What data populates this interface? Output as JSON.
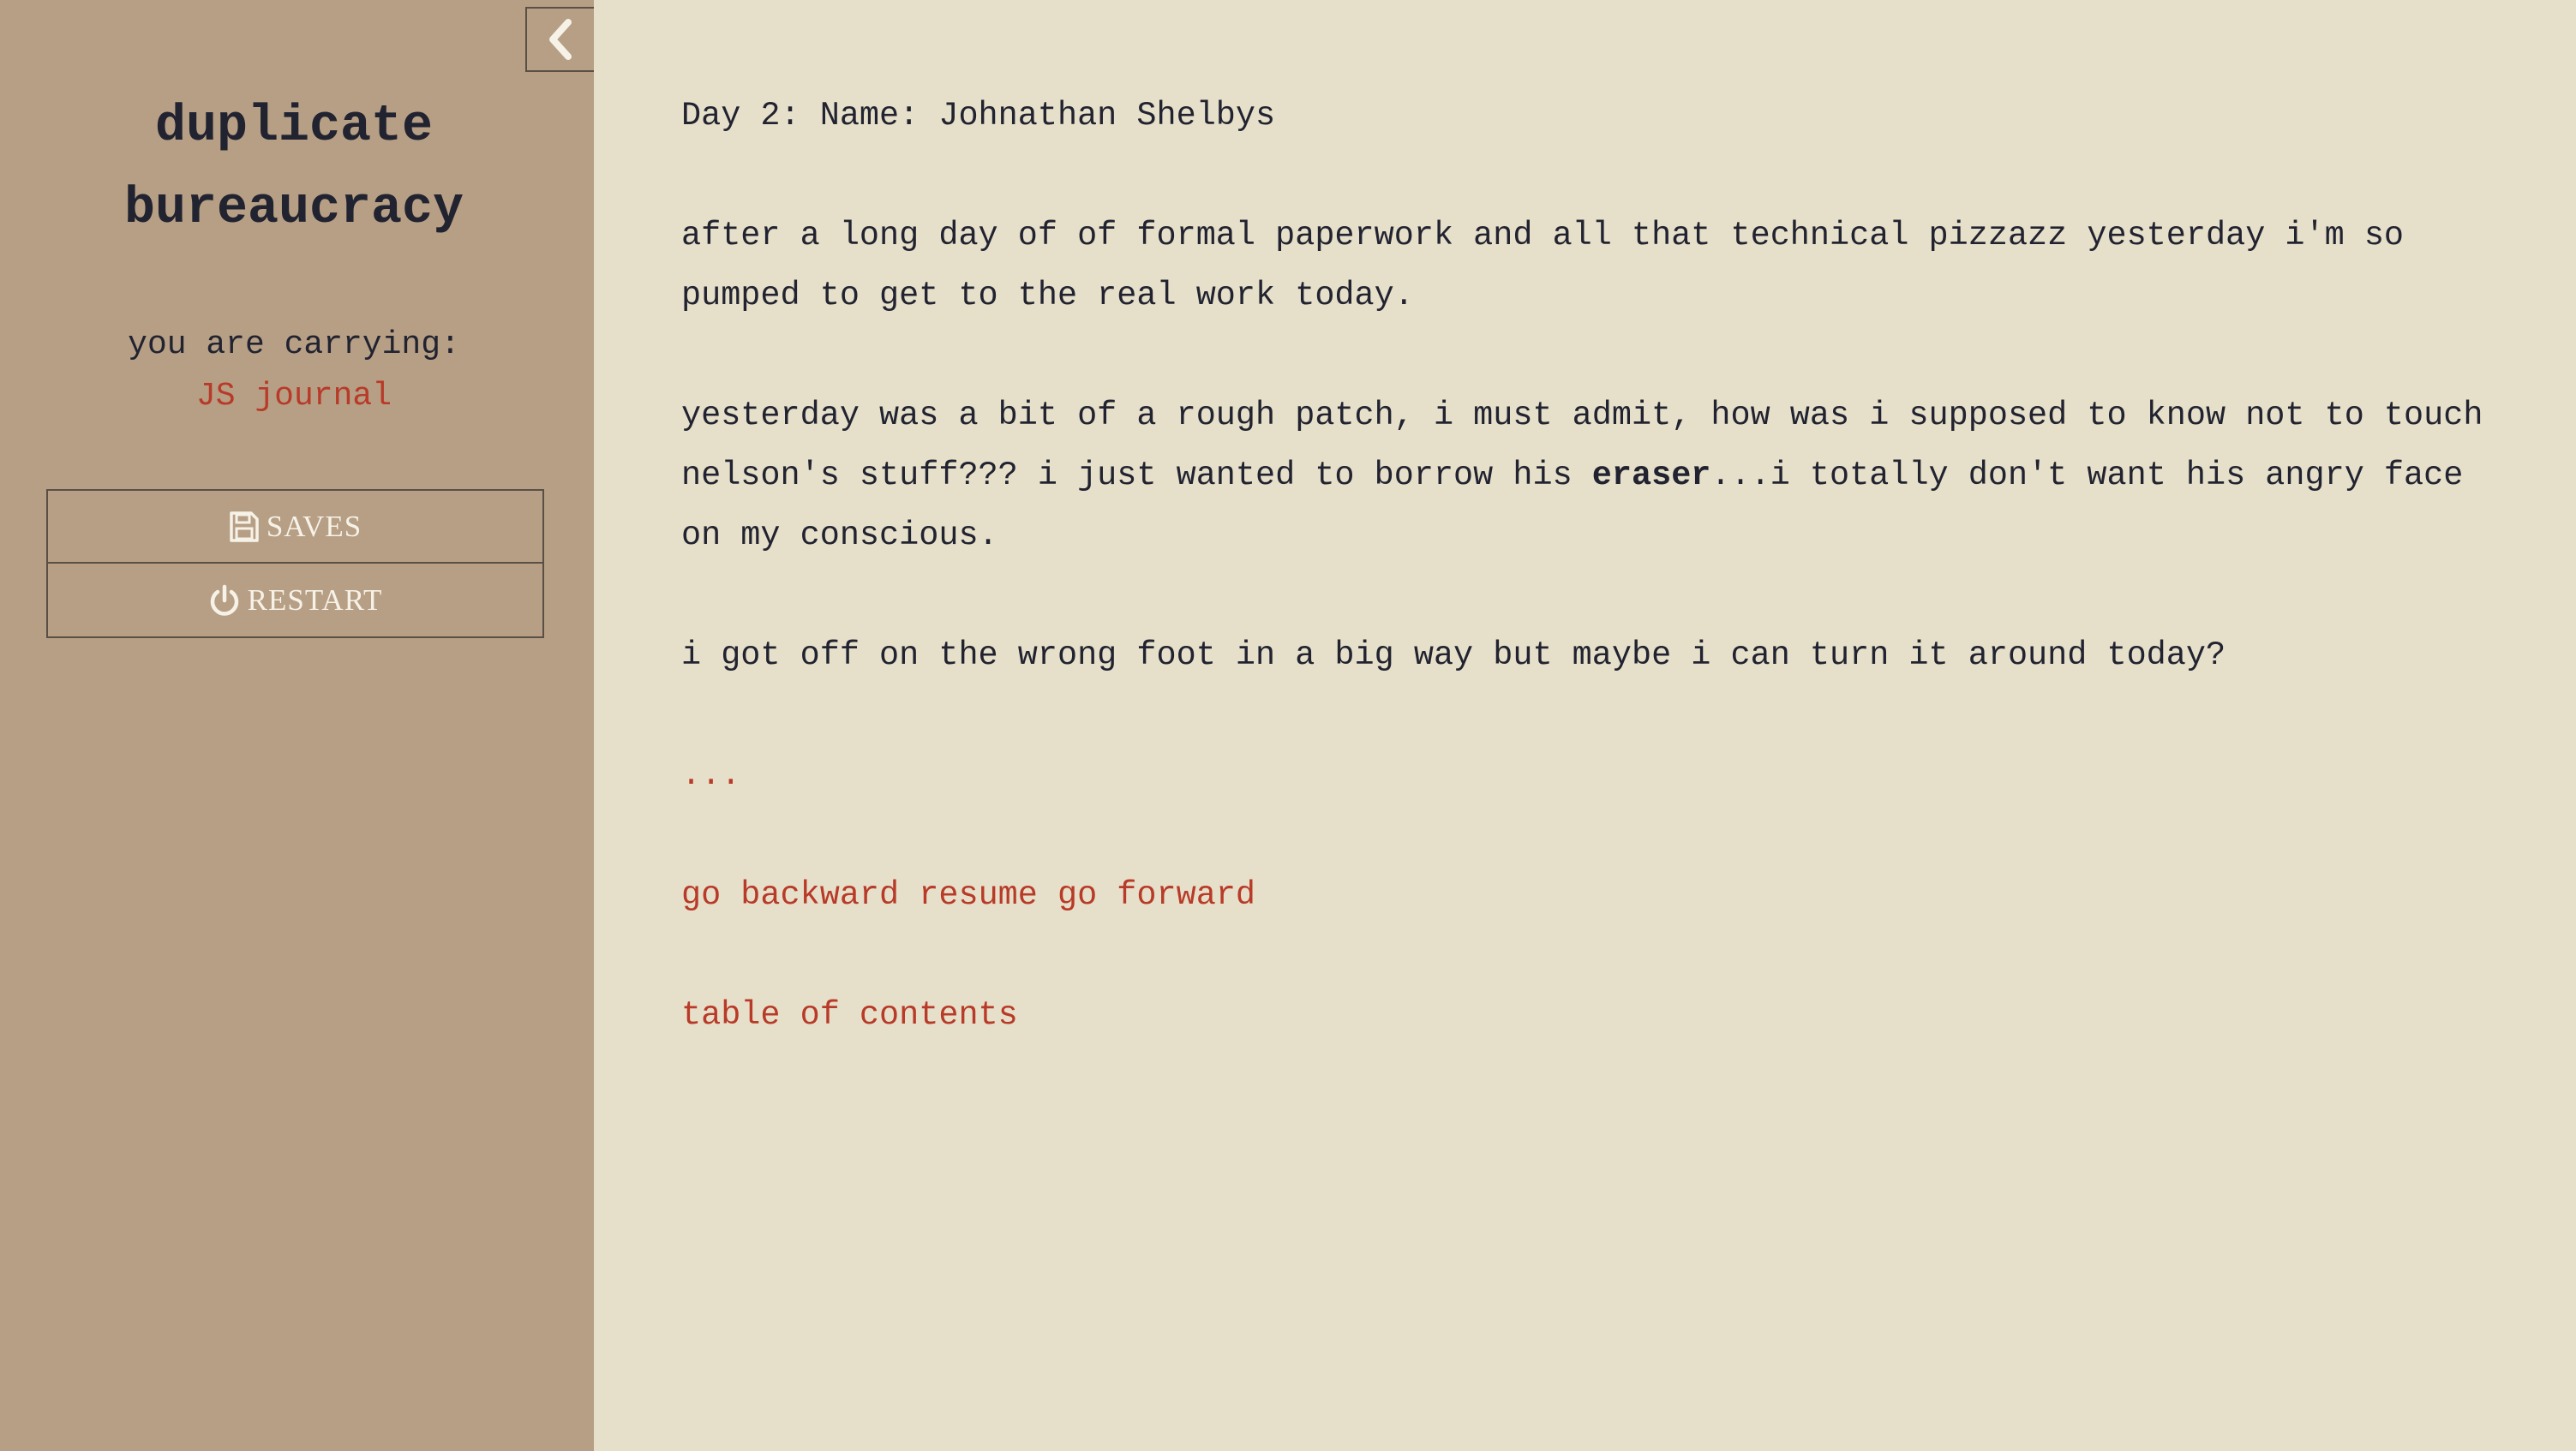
{
  "sidebar": {
    "title_line1": "duplicate",
    "title_line2": "bureaucracy",
    "carrying_label": "you are carrying:",
    "carrying_item": "JS journal",
    "menu": {
      "saves_label": "SAVES",
      "restart_label": "RESTART"
    }
  },
  "passage": {
    "heading": "Day 2: Name: Johnathan Shelbys",
    "para1": "after a long day of of formal paperwork and all that technical pizzazz yesterday i'm so pumped to get to the real work today.",
    "para2_before": "yesterday was a bit of a rough patch, i must admit, how was i supposed to know not to touch nelson's stuff??? i just wanted to borrow his ",
    "para2_bold": "eraser",
    "para2_after": "...i totally don't want his angry face on my conscious.",
    "para3": "i got off on the wrong foot in a big way but maybe i can turn it around today?",
    "ellipsis_link": "...",
    "nav": {
      "backward": "go backward",
      "resume": "resume",
      "forward": "go forward"
    },
    "toc_link": "table of contents"
  },
  "colors": {
    "sidebar_bg": "#b69f85",
    "page_bg": "#e6e0ca",
    "text": "#222330",
    "link": "#b83a28"
  }
}
